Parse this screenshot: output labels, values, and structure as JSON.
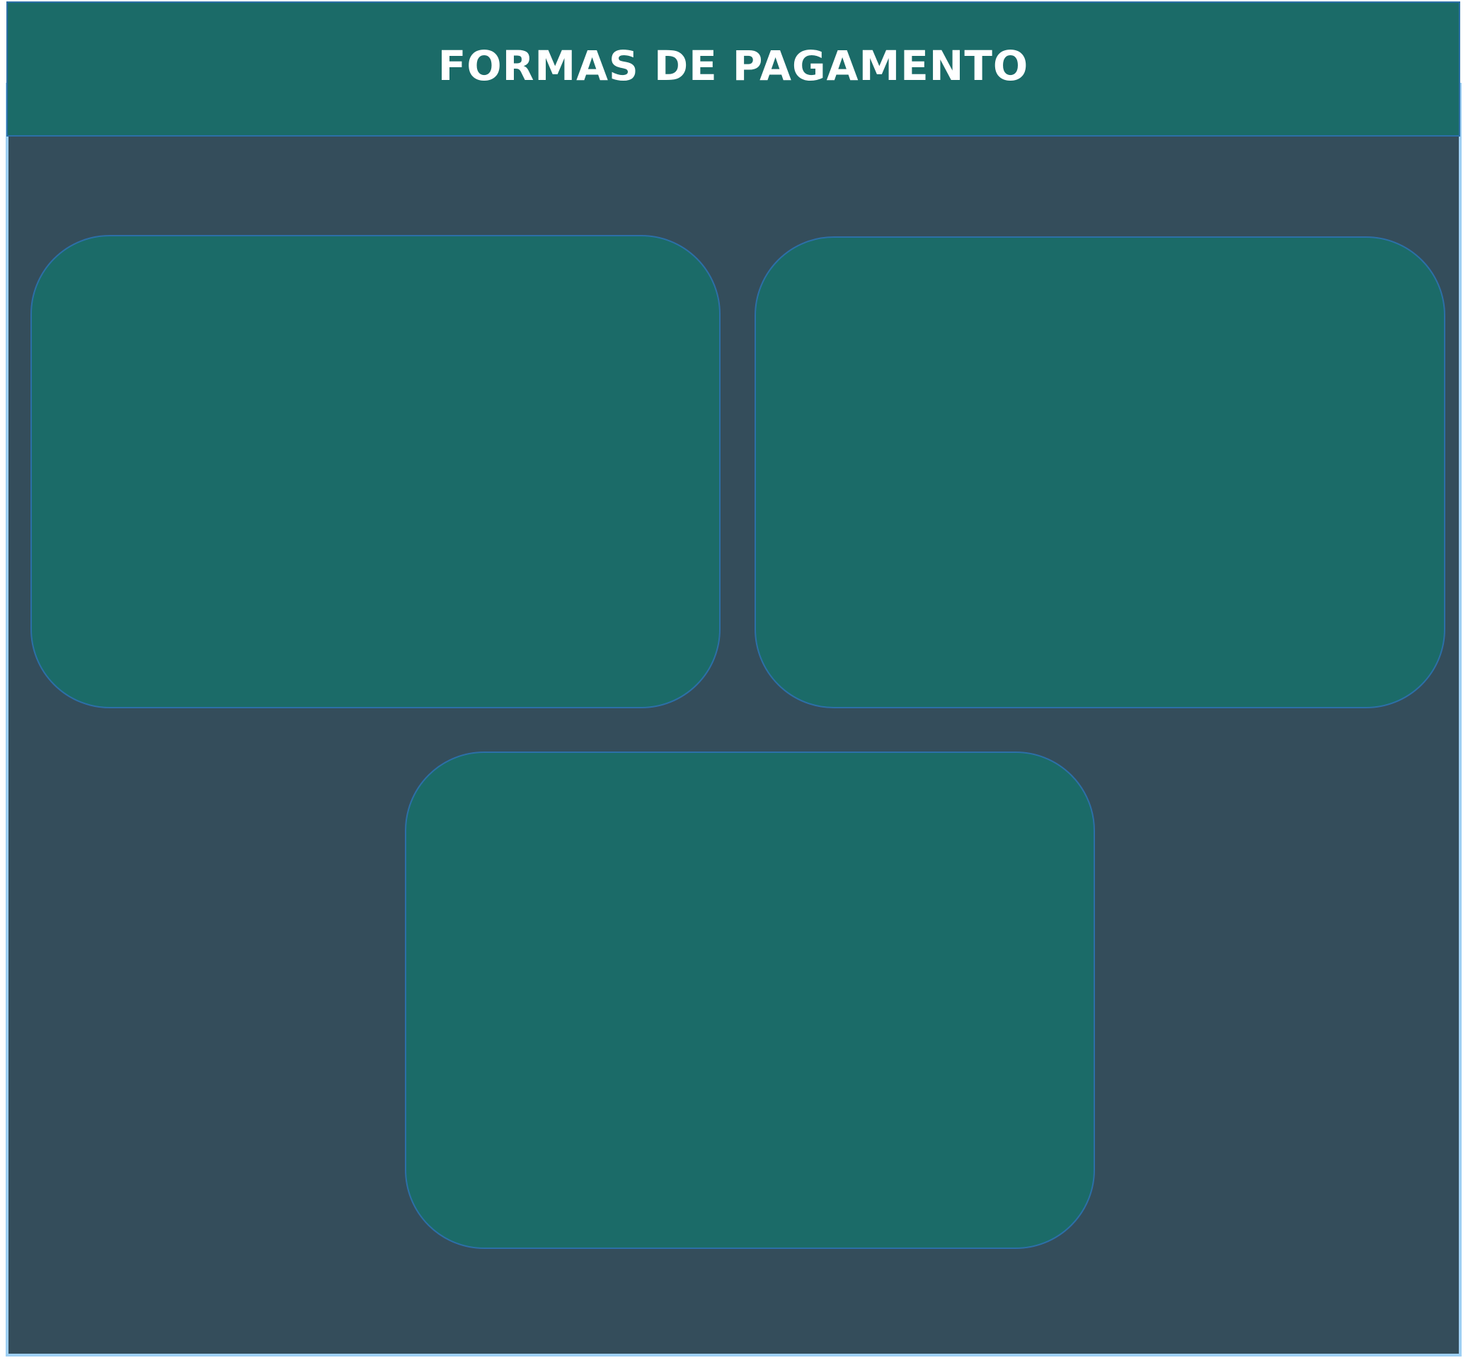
{
  "header": {
    "title": "FORMAS DE PAGAMENTO"
  },
  "colors": {
    "background_panel": "#344d5b",
    "panel_border": "#9fd0f4",
    "header_fill": "#1b6b68",
    "card_fill": "#1b6b68",
    "card_border": "#2c6fa7",
    "title_text": "#ffffff"
  },
  "cards": [
    {
      "text": ""
    },
    {
      "text": ""
    },
    {
      "text": ""
    }
  ]
}
